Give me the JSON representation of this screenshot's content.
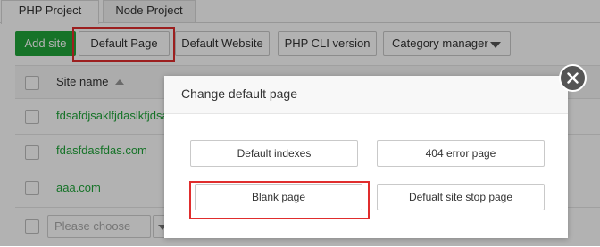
{
  "tabs": [
    {
      "label": "PHP Project",
      "active": true
    },
    {
      "label": "Node Project",
      "active": false
    }
  ],
  "toolbar": {
    "add_site": "Add site",
    "default_page": "Default Page",
    "default_website": "Default Website",
    "php_cli_version": "PHP CLI version",
    "category_manager": "Category manager"
  },
  "table": {
    "header": {
      "site_name": "Site name"
    },
    "rows": [
      {
        "name": "fdsafdjsaklfjdaslkfjdsaklfj"
      },
      {
        "name": "fdasfdasfdas.com"
      },
      {
        "name": "aaa.com"
      }
    ]
  },
  "footer": {
    "select_placeholder": "Please choose"
  },
  "modal": {
    "title": "Change default page",
    "options": {
      "default_indexes": "Default indexes",
      "error_404": "404 error page",
      "blank_page": "Blank page",
      "site_stop": "Defualt site stop page"
    }
  },
  "colors": {
    "primary": "#20a53a",
    "highlight": "#e02d2d"
  },
  "icons": {
    "close": "close-icon",
    "sort": "sort-up-icon",
    "dropdown": "chevron-down-icon"
  }
}
